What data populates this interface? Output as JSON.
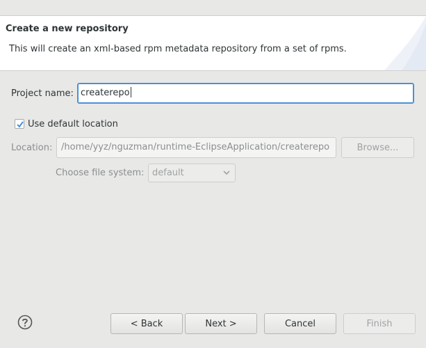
{
  "header": {
    "title": "Create a new repository",
    "description": "This will create an xml-based rpm metadata repository from a set of rpms."
  },
  "form": {
    "project_name_label": "Project name:",
    "project_name_value": "createrepo",
    "use_default_label": "Use default location",
    "use_default_checked": true,
    "location_label": "Location:",
    "location_value": "/home/yyz/nguzman/runtime-EclipseApplication/createrepo",
    "browse_label": "Browse...",
    "file_system_label": "Choose file system:",
    "file_system_value": "default"
  },
  "footer": {
    "help_icon": "question-circle-icon",
    "back_label": "< Back",
    "next_label": "Next >",
    "cancel_label": "Cancel",
    "finish_label": "Finish"
  },
  "colors": {
    "background": "#e8e8e7",
    "banner": "#ffffff",
    "focus": "#4a90d9",
    "disabled_text": "#8b8e8f"
  }
}
